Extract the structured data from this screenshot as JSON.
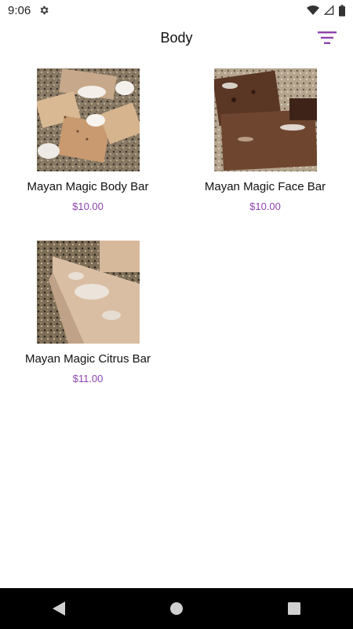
{
  "status_bar": {
    "time": "9:06",
    "icons": [
      "settings-icon",
      "wifi-icon",
      "signal-icon",
      "battery-icon"
    ]
  },
  "app_bar": {
    "title": "Body",
    "filter_icon": "filter-icon",
    "accent_color": "#8e44ad"
  },
  "products": [
    {
      "name": "Mayan Magic Body Bar",
      "price": "$10.00"
    },
    {
      "name": "Mayan Magic Face Bar",
      "price": "$10.00"
    },
    {
      "name": "Mayan Magic Citrus Bar",
      "price": "$11.00"
    }
  ],
  "nav_bar": {
    "icons": [
      "back-icon",
      "home-icon",
      "recents-icon"
    ]
  }
}
